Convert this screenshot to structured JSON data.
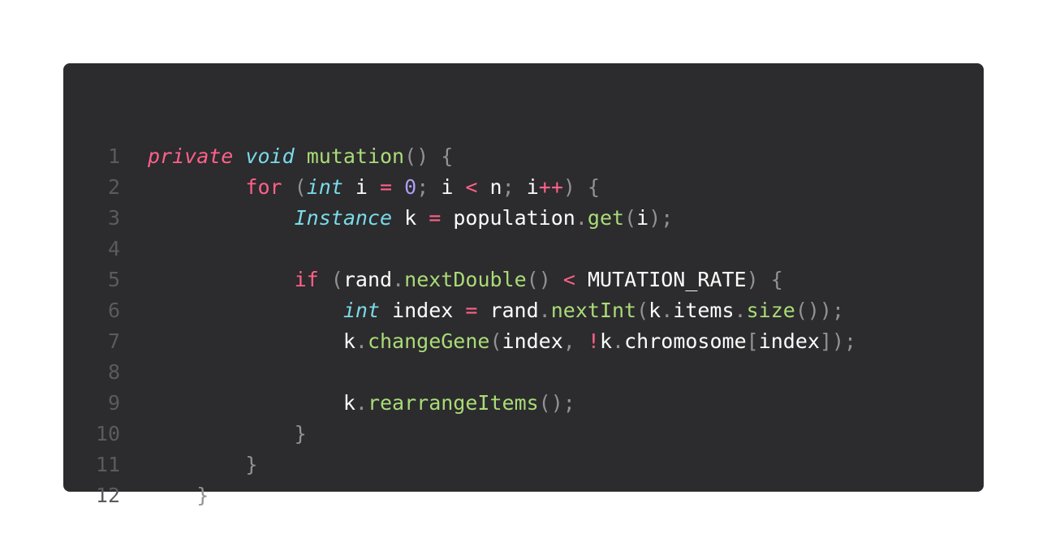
{
  "editor": {
    "colors": {
      "background": "#2c2b2e",
      "line_number": "#5b5a5e",
      "keyword": "#ff6188",
      "type": "#78dce8",
      "function": "#a9dc76",
      "number": "#ab9df2",
      "punctuation": "#939293",
      "identifier": "#fcfcfa"
    },
    "lines": [
      {
        "n": "1",
        "tokens": [
          {
            "t": "private",
            "c": "kwi"
          },
          {
            "t": " ",
            "c": "id"
          },
          {
            "t": "void",
            "c": "ty"
          },
          {
            "t": " ",
            "c": "id"
          },
          {
            "t": "mutation",
            "c": "fn"
          },
          {
            "t": "()",
            "c": "pu"
          },
          {
            "t": " ",
            "c": "id"
          },
          {
            "t": "{",
            "c": "pu"
          }
        ]
      },
      {
        "n": "2",
        "tokens": [
          {
            "t": "        ",
            "c": "id"
          },
          {
            "t": "for",
            "c": "kw"
          },
          {
            "t": " ",
            "c": "id"
          },
          {
            "t": "(",
            "c": "pu"
          },
          {
            "t": "int",
            "c": "ty"
          },
          {
            "t": " i ",
            "c": "id"
          },
          {
            "t": "=",
            "c": "op"
          },
          {
            "t": " ",
            "c": "id"
          },
          {
            "t": "0",
            "c": "num"
          },
          {
            "t": ";",
            "c": "pu"
          },
          {
            "t": " i ",
            "c": "id"
          },
          {
            "t": "<",
            "c": "op"
          },
          {
            "t": " n",
            "c": "id"
          },
          {
            "t": ";",
            "c": "pu"
          },
          {
            "t": " i",
            "c": "id"
          },
          {
            "t": "++",
            "c": "op"
          },
          {
            "t": ")",
            "c": "pu"
          },
          {
            "t": " ",
            "c": "id"
          },
          {
            "t": "{",
            "c": "pu"
          }
        ]
      },
      {
        "n": "3",
        "tokens": [
          {
            "t": "            ",
            "c": "id"
          },
          {
            "t": "Instance",
            "c": "ty"
          },
          {
            "t": " k ",
            "c": "id"
          },
          {
            "t": "=",
            "c": "op"
          },
          {
            "t": " population",
            "c": "id"
          },
          {
            "t": ".",
            "c": "pu"
          },
          {
            "t": "get",
            "c": "fn"
          },
          {
            "t": "(",
            "c": "pu"
          },
          {
            "t": "i",
            "c": "id"
          },
          {
            "t": ");",
            "c": "pu"
          }
        ]
      },
      {
        "n": "4",
        "tokens": []
      },
      {
        "n": "5",
        "tokens": [
          {
            "t": "            ",
            "c": "id"
          },
          {
            "t": "if",
            "c": "kw"
          },
          {
            "t": " ",
            "c": "id"
          },
          {
            "t": "(",
            "c": "pu"
          },
          {
            "t": "rand",
            "c": "id"
          },
          {
            "t": ".",
            "c": "pu"
          },
          {
            "t": "nextDouble",
            "c": "fn"
          },
          {
            "t": "()",
            "c": "pu"
          },
          {
            "t": " ",
            "c": "id"
          },
          {
            "t": "<",
            "c": "op"
          },
          {
            "t": " MUTATION_RATE",
            "c": "id"
          },
          {
            "t": ")",
            "c": "pu"
          },
          {
            "t": " ",
            "c": "id"
          },
          {
            "t": "{",
            "c": "pu"
          }
        ]
      },
      {
        "n": "6",
        "tokens": [
          {
            "t": "                ",
            "c": "id"
          },
          {
            "t": "int",
            "c": "ty"
          },
          {
            "t": " index ",
            "c": "id"
          },
          {
            "t": "=",
            "c": "op"
          },
          {
            "t": " rand",
            "c": "id"
          },
          {
            "t": ".",
            "c": "pu"
          },
          {
            "t": "nextInt",
            "c": "fn"
          },
          {
            "t": "(",
            "c": "pu"
          },
          {
            "t": "k",
            "c": "id"
          },
          {
            "t": ".",
            "c": "pu"
          },
          {
            "t": "items",
            "c": "id"
          },
          {
            "t": ".",
            "c": "pu"
          },
          {
            "t": "size",
            "c": "fn"
          },
          {
            "t": "());",
            "c": "pu"
          }
        ]
      },
      {
        "n": "7",
        "tokens": [
          {
            "t": "                ",
            "c": "id"
          },
          {
            "t": "k",
            "c": "id"
          },
          {
            "t": ".",
            "c": "pu"
          },
          {
            "t": "changeGene",
            "c": "fn"
          },
          {
            "t": "(",
            "c": "pu"
          },
          {
            "t": "index",
            "c": "id"
          },
          {
            "t": ",",
            "c": "pu"
          },
          {
            "t": " ",
            "c": "id"
          },
          {
            "t": "!",
            "c": "op"
          },
          {
            "t": "k",
            "c": "id"
          },
          {
            "t": ".",
            "c": "pu"
          },
          {
            "t": "chromosome",
            "c": "id"
          },
          {
            "t": "[",
            "c": "pu"
          },
          {
            "t": "index",
            "c": "id"
          },
          {
            "t": "]);",
            "c": "pu"
          }
        ]
      },
      {
        "n": "8",
        "tokens": []
      },
      {
        "n": "9",
        "tokens": [
          {
            "t": "                ",
            "c": "id"
          },
          {
            "t": "k",
            "c": "id"
          },
          {
            "t": ".",
            "c": "pu"
          },
          {
            "t": "rearrangeItems",
            "c": "fn"
          },
          {
            "t": "();",
            "c": "pu"
          }
        ]
      },
      {
        "n": "10",
        "tokens": [
          {
            "t": "            ",
            "c": "id"
          },
          {
            "t": "}",
            "c": "pu"
          }
        ]
      },
      {
        "n": "11",
        "tokens": [
          {
            "t": "        ",
            "c": "id"
          },
          {
            "t": "}",
            "c": "pu"
          }
        ]
      },
      {
        "n": "12",
        "tokens": [
          {
            "t": "    ",
            "c": "id"
          },
          {
            "t": "}",
            "c": "pu"
          }
        ]
      }
    ]
  }
}
